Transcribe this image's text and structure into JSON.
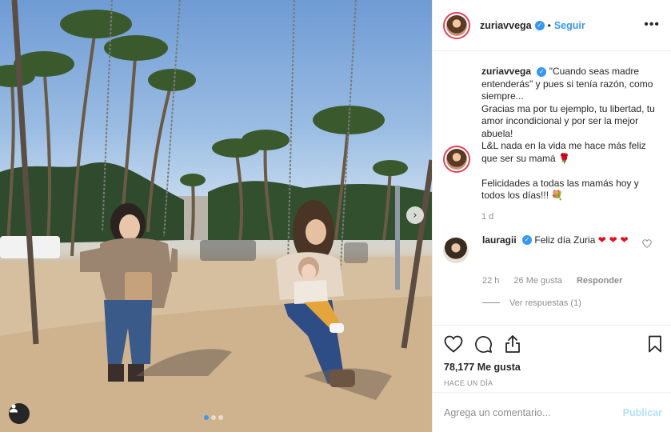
{
  "post": {
    "username": "zuriavvega",
    "follow_label": "Seguir",
    "separator": "•",
    "more_label": "•••",
    "caption": "\"Cuando seas madre entenderás\" y pues si tenía razón, como siempre...\nGracias ma por tu ejemplo, tu libertad, tu amor incondicional y por ser la mejor abuela!\nL&L nada en la vida me hace más feliz que ser su mamá 🌹\n\nFelicidades a todas las mamás hoy y todos los días!!! 💐",
    "caption_time": "1 d",
    "likes": "78,177 Me gusta",
    "post_time": "HACE UN DÍA",
    "add_comment_placeholder": "Agrega un comentario...",
    "publish_label": "Publicar"
  },
  "comment": {
    "username": "lauragii",
    "text": "Feliz día Zuria",
    "hearts": "❤ ❤ ❤",
    "time": "22 h",
    "likes": "26 Me gusta",
    "reply_label": "Responder",
    "view_replies": "Ver respuestas (1)"
  },
  "icons": {
    "verified": "verified-badge-icon",
    "like": "heart-icon",
    "comment": "comment-icon",
    "share": "share-icon",
    "save": "bookmark-icon",
    "user_tag": "user-icon",
    "next": "chevron-right-icon"
  },
  "carousel": {
    "total": 3,
    "active": 1
  },
  "colors": {
    "accent": "#3897f0",
    "muted": "#8e8e8e",
    "publish_disabled": "#b2dffc",
    "heart": "#e01020"
  }
}
